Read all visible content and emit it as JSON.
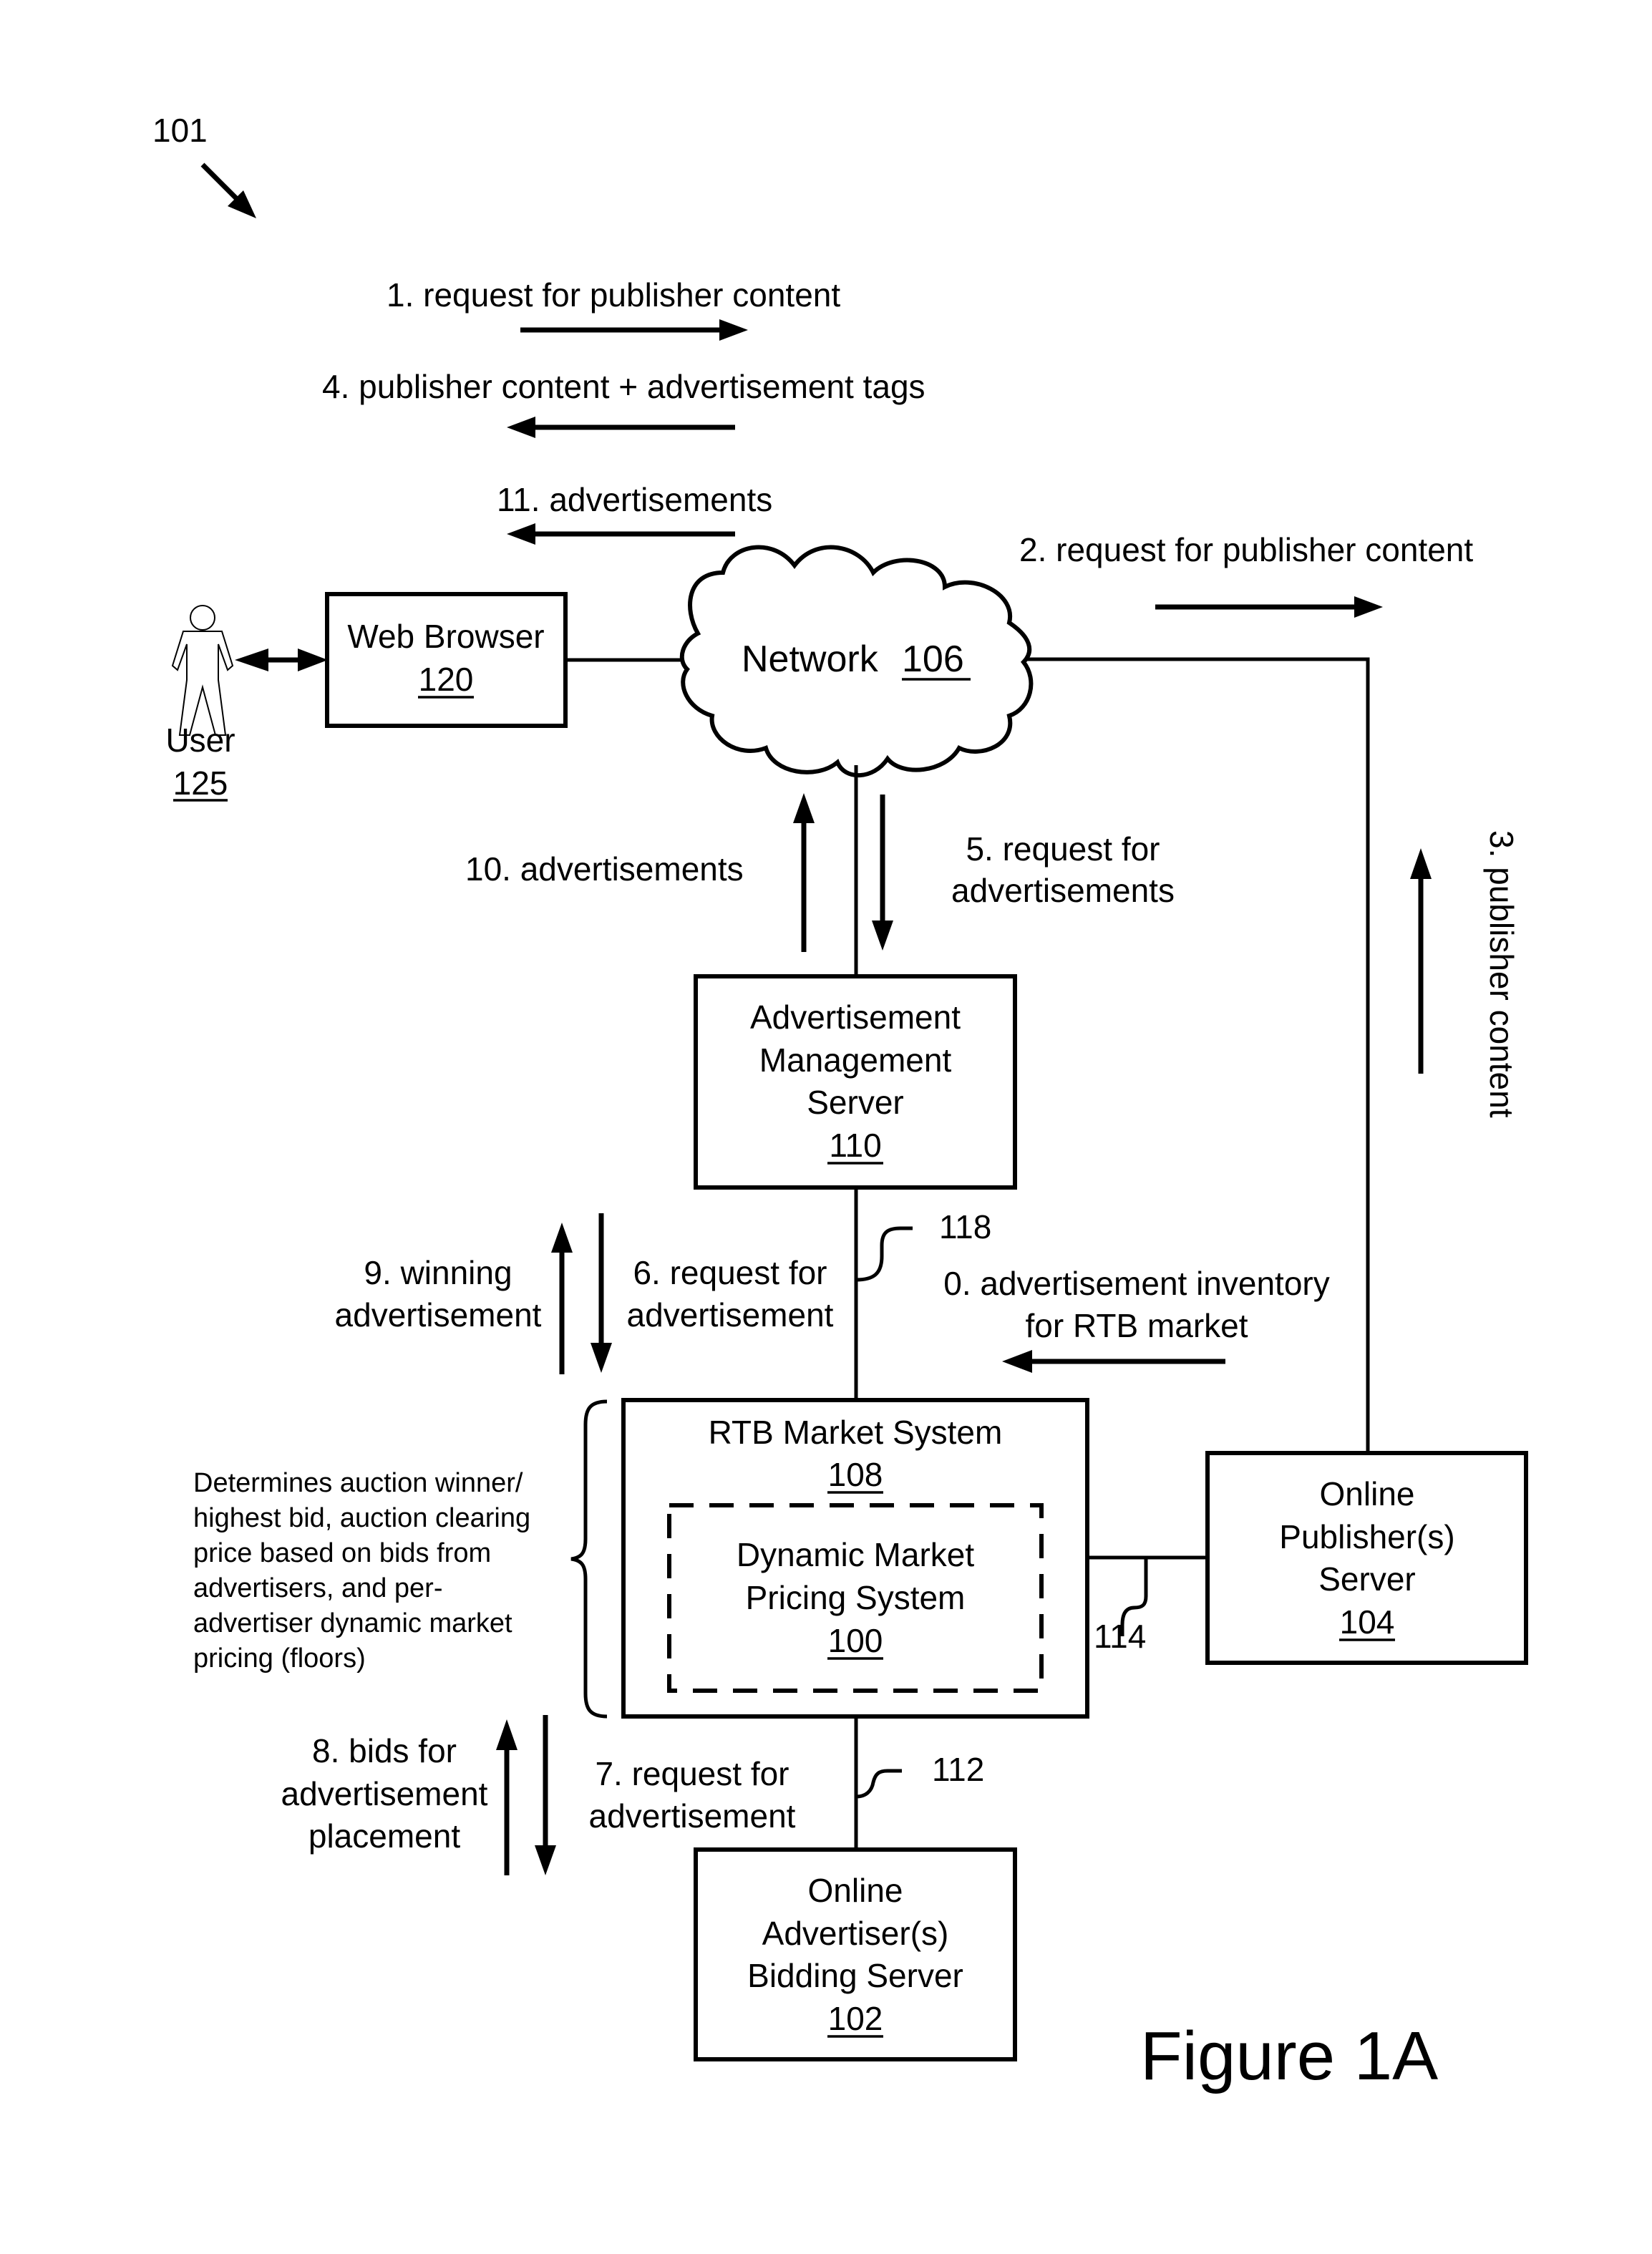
{
  "figure": {
    "ref_number": "101",
    "caption": "Figure 1A"
  },
  "nodes": {
    "user": {
      "label": "User",
      "ref": "125"
    },
    "web_browser": {
      "label": "Web Browser",
      "ref": "120"
    },
    "network": {
      "label": "Network",
      "ref": "106"
    },
    "ad_mgmt_server": {
      "lines": [
        "Advertisement",
        "Management",
        "Server"
      ],
      "ref": "110"
    },
    "rtb_market": {
      "label": "RTB Market System",
      "ref": "108"
    },
    "dynamic_pricing": {
      "lines": [
        "Dynamic Market",
        "Pricing System"
      ],
      "ref": "100"
    },
    "publisher_server": {
      "lines": [
        "Online",
        "Publisher(s)",
        "Server"
      ],
      "ref": "104"
    },
    "advertiser_server": {
      "lines": [
        "Online",
        "Advertiser(s)",
        "Bidding Server"
      ],
      "ref": "102"
    }
  },
  "connectors": {
    "c118": "118",
    "c114": "114",
    "c112": "112"
  },
  "flows": {
    "f1": "1. request for publisher content",
    "f2": "2. request for publisher content",
    "f3": "3. publisher content",
    "f4": "4. publisher content + advertisement tags",
    "f5": [
      "5. request for",
      "advertisements"
    ],
    "f6": [
      "6. request for",
      "advertisement"
    ],
    "f7": [
      "7. request for",
      "advertisement"
    ],
    "f8": [
      "8. bids for",
      "advertisement",
      "placement"
    ],
    "f9": [
      "9. winning",
      "advertisement"
    ],
    "f10": "10.  advertisements",
    "f11": "11. advertisements",
    "f0": [
      "0. advertisement inventory",
      "for RTB market"
    ]
  },
  "annotation": {
    "lines": [
      "Determines auction winner/",
      "highest bid, auction clearing",
      "price based on bids from",
      "advertisers, and per-",
      "advertiser dynamic market",
      "pricing (floors)"
    ]
  }
}
